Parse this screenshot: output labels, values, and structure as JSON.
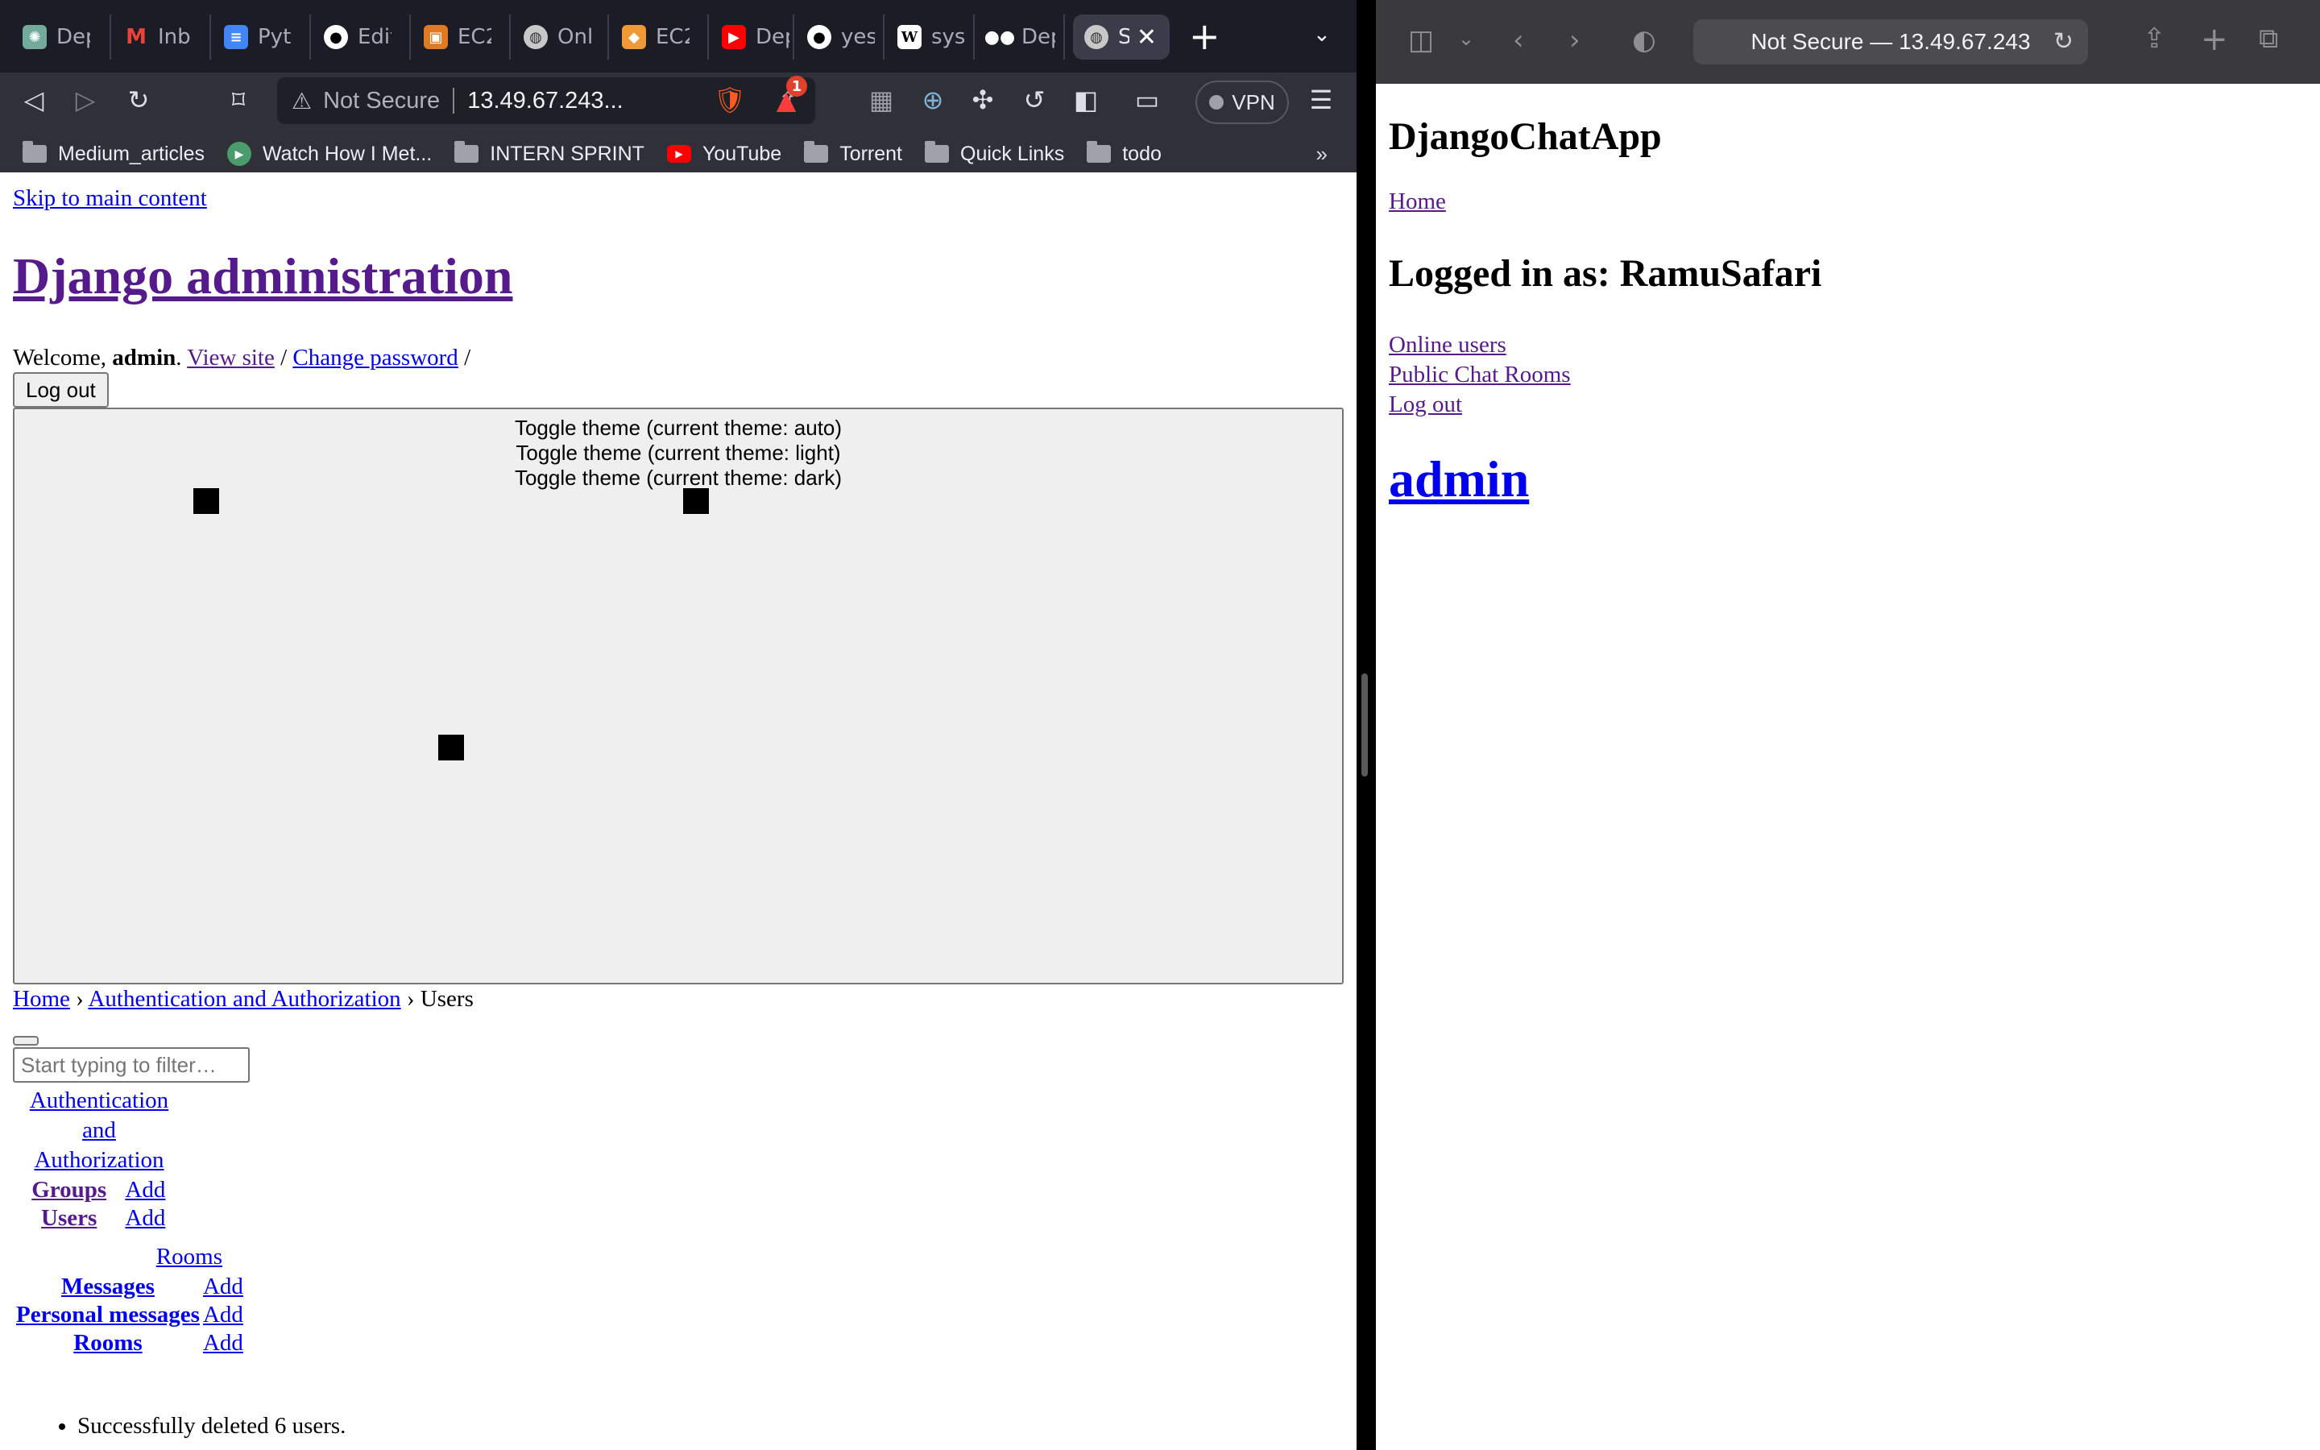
{
  "brave": {
    "tabs": [
      {
        "label": "Depl",
        "icon": "chatgpt-icon",
        "color": "#74aa9c"
      },
      {
        "label": "Inbo",
        "icon": "gmail-icon",
        "color": "#ea4335"
      },
      {
        "label": "Pyth",
        "icon": "google-docs-icon",
        "color": "#4285f4"
      },
      {
        "label": "Editi",
        "icon": "github-icon",
        "color": "#ffffff"
      },
      {
        "label": "EC2",
        "icon": "aws-ec2-icon",
        "color": "#e07b24"
      },
      {
        "label": "Onli",
        "icon": "globe-icon",
        "color": "#c8c8c8"
      },
      {
        "label": "EC2",
        "icon": "aws-box-icon",
        "color": "#f09a37"
      },
      {
        "label": "Dep",
        "icon": "youtube-icon",
        "color": "#ff0000"
      },
      {
        "label": "yesh",
        "icon": "github-icon",
        "color": "#ffffff"
      },
      {
        "label": "syst",
        "icon": "wikipedia-icon",
        "color": "#ffffff"
      },
      {
        "label": "Dep",
        "icon": "medium-icon",
        "color": "#ffffff"
      },
      {
        "label": "S",
        "icon": "globe-icon",
        "color": "#c8c8c8"
      }
    ],
    "address": {
      "warning": "Not Secure",
      "url": "13.49.67.243..."
    },
    "shields_badge": "1",
    "vpn_label": "VPN",
    "bookmarks": [
      {
        "label": "Medium_articles",
        "icon": "folder-icon"
      },
      {
        "label": "Watch How I Met...",
        "icon": "play-icon"
      },
      {
        "label": "INTERN SPRINT",
        "icon": "folder-icon"
      },
      {
        "label": "YouTube",
        "icon": "youtube-icon"
      },
      {
        "label": "Torrent",
        "icon": "folder-icon"
      },
      {
        "label": "Quick Links",
        "icon": "folder-icon"
      },
      {
        "label": "todo",
        "icon": "folder-icon"
      }
    ],
    "bookmarks_more": "»",
    "page": {
      "skip_link": "Skip to main content",
      "site_title": "Django administration",
      "welcome_prefix": "Welcome,",
      "username": "admin",
      "view_site": "View site",
      "change_password": "Change password",
      "logout_button": "Log out",
      "theme_toggles": [
        "Toggle theme (current theme: auto)",
        "Toggle theme (current theme: light)",
        "Toggle theme (current theme: dark)"
      ],
      "breadcrumbs": {
        "home": "Home",
        "section": "Authentication and Authorization",
        "current": "Users",
        "separator": "›"
      },
      "filter_placeholder": "Start typing to filter…",
      "apps": [
        {
          "caption": "Authentication and Authorization",
          "models": [
            {
              "name": "Groups",
              "add": "Add"
            },
            {
              "name": "Users",
              "add": "Add"
            }
          ]
        },
        {
          "caption": "Rooms",
          "models": [
            {
              "name": "Messages",
              "add": "Add"
            },
            {
              "name": "Personal messages",
              "add": "Add"
            },
            {
              "name": "Rooms",
              "add": "Add"
            }
          ]
        }
      ],
      "messages": [
        "Successfully deleted 6 users."
      ]
    }
  },
  "safari": {
    "address": "Not Secure — 13.49.67.243",
    "page": {
      "app_title": "DjangoChatApp",
      "home_link": "Home",
      "logged_in": "Logged in as: RamuSafari",
      "links": [
        "Online users",
        "Public Chat Rooms",
        "Log out"
      ],
      "admin_link": "admin"
    }
  }
}
